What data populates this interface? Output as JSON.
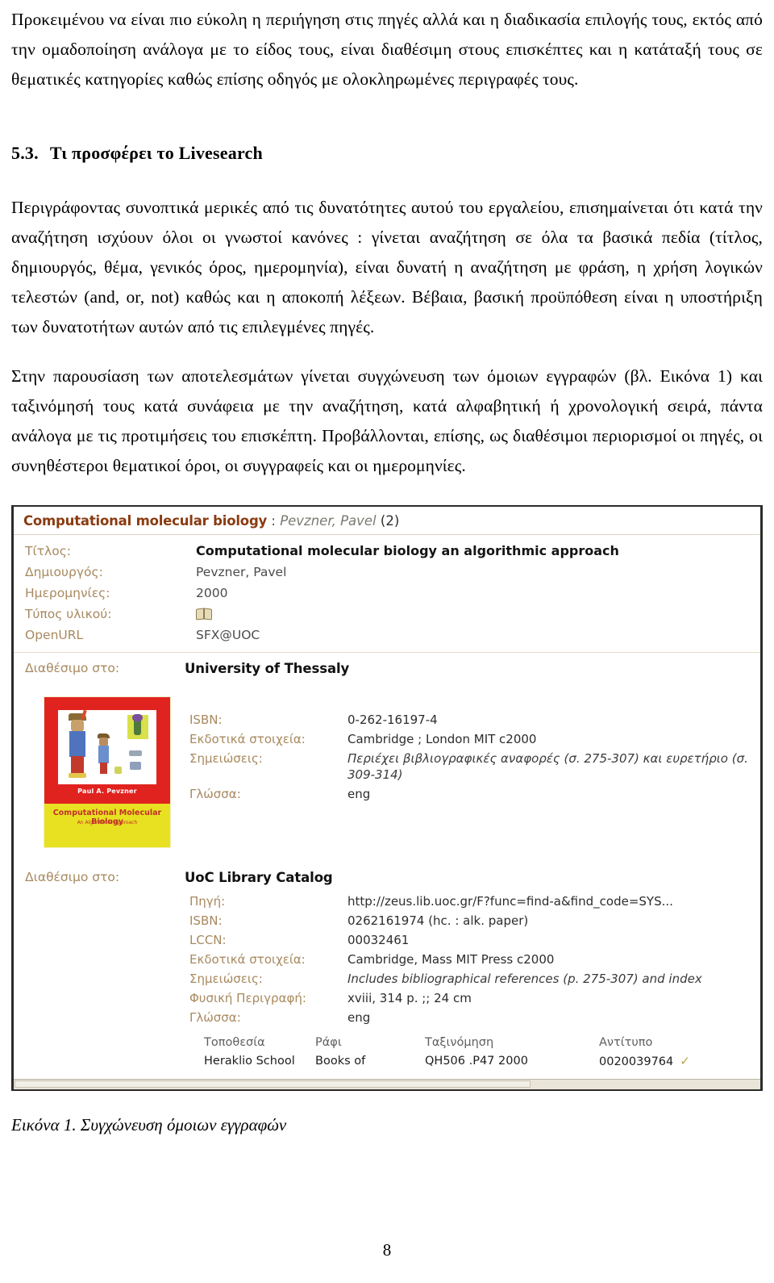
{
  "document": {
    "page_number": "8",
    "paragraph_1": "Προκειμένου να είναι πιο εύκολη η περιήγηση στις πηγές αλλά και η διαδικασία επιλογής τους, εκτός από την ομαδοποίηση ανάλογα με το είδος τους, είναι διαθέσιμη στους επισκέπτες και η κατάταξή τους σε θεματικές κατηγορίες καθώς επίσης οδηγός με ολοκληρωμένες περιγραφές τους.",
    "section": {
      "number": "5.3.",
      "title": "Τι προσφέρει το Livesearch"
    },
    "paragraph_2": "Περιγράφοντας συνοπτικά μερικές από τις δυνατότητες αυτού του εργαλείου, επισημαίνεται ότι κατά την αναζήτηση ισχύουν όλοι οι γνωστοί κανόνες : γίνεται αναζήτηση σε όλα τα βασικά πεδία (τίτλος, δημιουργός, θέμα, γενικός όρος, ημερομηνία), είναι δυνατή η αναζήτηση με φράση, η χρήση λογικών τελεστών (and, or, not) καθώς και η αποκοπή λέξεων. Βέβαια, βασική προϋπόθεση είναι η υποστήριξη των δυνατοτήτων αυτών από τις επιλεγμένες πηγές.",
    "paragraph_3": "Στην παρουσίαση των αποτελεσμάτων γίνεται συγχώνευση των όμοιων εγγραφών (βλ. Εικόνα 1) και ταξινόμησή τους κατά συνάφεια με την αναζήτηση, κατά αλφαβητική ή χρονολογική σειρά, πάντα  ανάλογα με τις προτιμήσεις του επισκέπτη. Προβάλλονται, επίσης, ως διαθέσιμοι περιορισμοί οι πηγές, οι συνηθέστεροι θεματικοί όροι, οι συγγραφείς και οι ημερομηνίες.",
    "figure_caption": "Εικόνα 1. Συγχώνευση όμοιων εγγραφών"
  },
  "figure": {
    "record_header": {
      "title": "Computational molecular biology",
      "separator": " : ",
      "author": "Pevzner, Pavel",
      "count": " (2)"
    },
    "main_fields": [
      {
        "label": "Τίτλος:",
        "value": "Computational molecular biology an algorithmic approach",
        "style": "strong"
      },
      {
        "label": "Δημιουργός:",
        "value": "Pevzner, Pavel",
        "style": "plain"
      },
      {
        "label": "Ημερομηνίες:",
        "value": "2000",
        "style": "plain"
      },
      {
        "label": "Τύπος υλικού:",
        "value": "",
        "style": "icon",
        "icon": "book-icon"
      },
      {
        "label": "OpenURL",
        "value": "SFX@UOC",
        "style": "plain"
      }
    ],
    "source_1": {
      "available_label": "Διαθέσιμο στο:",
      "available_value": "University of Thessaly",
      "cover": {
        "author": "Paul A. Pevzner",
        "title": "Computational Molecular Biology",
        "subtitle": "An Algorithmic Approach"
      },
      "fields": [
        {
          "label": "ISBN:",
          "value": "0-262-16197-4",
          "style": "plain"
        },
        {
          "label": "Εκδοτικά στοιχεία:",
          "value": "Cambridge ; London MIT c2000",
          "style": "plain"
        },
        {
          "label": "Σημειώσεις:",
          "value": "Περιέχει βιβλιογραφικές αναφορές (σ. 275-307) και ευρετήριο (σ. 309-314)",
          "style": "italic"
        },
        {
          "label": "Γλώσσα:",
          "value": "eng",
          "style": "plain"
        }
      ]
    },
    "source_2": {
      "available_label": "Διαθέσιμο στο:",
      "available_value": "UoC Library Catalog",
      "fields": [
        {
          "label": "Πηγή:",
          "value": "http://zeus.lib.uoc.gr/F?func=find-a&find_code=SYS...",
          "style": "plain"
        },
        {
          "label": "ISBN:",
          "value": "0262161974 (hc. : alk. paper)",
          "style": "plain"
        },
        {
          "label": "LCCN:",
          "value": "00032461",
          "style": "plain"
        },
        {
          "label": "Εκδοτικά στοιχεία:",
          "value": "Cambridge, Mass MIT Press c2000",
          "style": "plain"
        },
        {
          "label": "Σημειώσεις:",
          "value": "Includes bibliographical references (p. 275-307) and index",
          "style": "italic"
        },
        {
          "label": "Φυσική Περιγραφή:",
          "value": "xviii, 314 p. ;; 24 cm",
          "style": "plain"
        },
        {
          "label": "Γλώσσα:",
          "value": "eng",
          "style": "plain"
        }
      ],
      "holdings": {
        "columns": [
          "Τοποθεσία",
          "Ράφι",
          "Ταξινόμηση",
          "Αντίτυπο"
        ],
        "rows": [
          {
            "location": "Heraklio School",
            "shelf": "Books of",
            "classification": "QH506 .P47 2000",
            "copy": "0020039764",
            "status": "✓"
          }
        ]
      }
    },
    "colors": {
      "record_title": "#8a3b10",
      "field_label": "#a8895f",
      "divider": "#e6ddca",
      "check": "#b9a34d",
      "cover_red": "#e1231f",
      "cover_yellow": "#e8e121"
    }
  }
}
